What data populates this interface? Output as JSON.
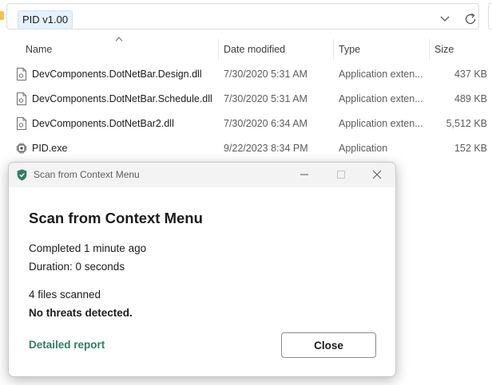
{
  "address_bar": {
    "path_chip": "PID v1.00",
    "chevron_icon": "chevron-down-icon",
    "refresh_icon": "refresh-icon"
  },
  "columns": {
    "name": "Name",
    "date_modified": "Date modified",
    "type": "Type",
    "size": "Size"
  },
  "files": [
    {
      "name": "DevComponents.DotNetBar.Design.dll",
      "date": "7/30/2020 5:31 AM",
      "type": "Application exten...",
      "size": "437 KB",
      "icon": "dll-file-icon"
    },
    {
      "name": "DevComponents.DotNetBar.Schedule.dll",
      "date": "7/30/2020 5:31 AM",
      "type": "Application exten...",
      "size": "489 KB",
      "icon": "dll-file-icon"
    },
    {
      "name": "DevComponents.DotNetBar2.dll",
      "date": "7/30/2020 6:34 AM",
      "type": "Application exten...",
      "size": "5,512 KB",
      "icon": "dll-file-icon"
    },
    {
      "name": "PID.exe",
      "date": "9/22/2023 8:34 PM",
      "type": "Application",
      "size": "152 KB",
      "icon": "exe-chip-icon"
    }
  ],
  "dialog": {
    "window_title": "Scan from Context Menu",
    "heading": "Scan from Context Menu",
    "completed": "Completed 1 minute ago",
    "duration": "Duration: 0 seconds",
    "files_scanned": "4 files scanned",
    "result": "No threats detected.",
    "report_link": "Detailed report",
    "close_button": "Close",
    "accent_color": "#2e7d66"
  }
}
